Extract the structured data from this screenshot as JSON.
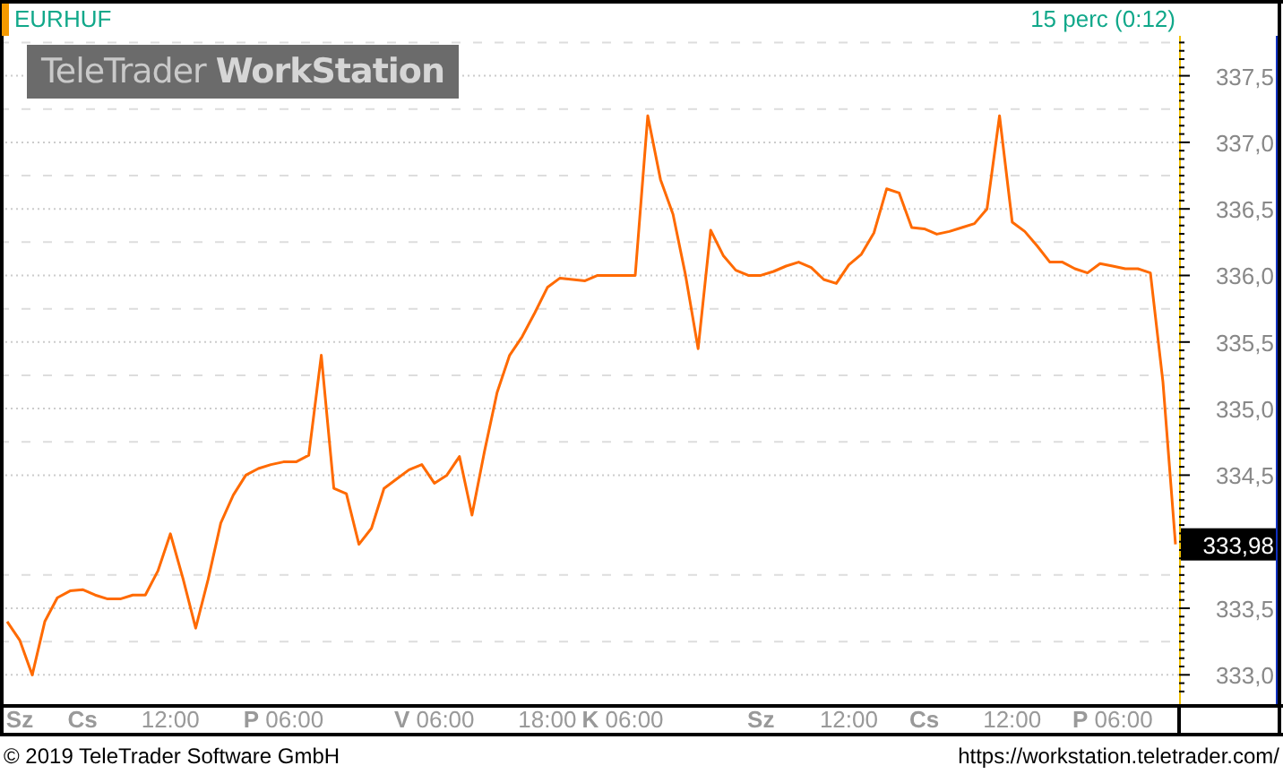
{
  "header": {
    "interval": "15 perc (0:12)"
  },
  "logo": "TeleTrader **WorkStation**",
  "last_price": "333,98",
  "chart_data": {
    "type": "line",
    "grid": true,
    "ylim": [
      332.78,
      337.8
    ],
    "categories": [
      null,
      "**Sz**",
      null,
      null,
      null,
      null,
      "**Cs**",
      null,
      null,
      null,
      null,
      null,
      null,
      "12:00",
      null,
      null,
      null,
      null,
      null,
      null,
      null,
      null,
      "**P** 06:00",
      null,
      null,
      null,
      null,
      null,
      null,
      null,
      null,
      null,
      null,
      null,
      "**V** 06:00",
      null,
      null,
      null,
      null,
      null,
      null,
      null,
      null,
      "18:00",
      null,
      null,
      null,
      null,
      null,
      "**K** 06:00",
      null,
      null,
      null,
      null,
      null,
      null,
      null,
      null,
      null,
      null,
      "**Sz**",
      null,
      null,
      null,
      null,
      null,
      null,
      "12:00",
      null,
      null,
      null,
      null,
      null,
      "**Cs**",
      null,
      null,
      null,
      null,
      null,
      null,
      "12:00",
      null,
      null,
      null,
      null,
      null,
      null,
      null,
      "**P** 06:00",
      null,
      null,
      null,
      null,
      null
    ],
    "series": [
      {
        "name": "EURHUF",
        "color": "#ff6a00",
        "values": [
          333.4,
          333.26,
          333.0,
          333.4,
          333.58,
          333.63,
          333.64,
          333.6,
          333.57,
          333.57,
          333.6,
          333.6,
          333.78,
          334.06,
          333.72,
          333.35,
          333.72,
          334.14,
          334.35,
          334.5,
          334.55,
          334.58,
          334.6,
          334.6,
          334.65,
          335.4,
          334.4,
          334.36,
          333.98,
          334.1,
          334.4,
          334.47,
          334.54,
          334.58,
          334.44,
          334.5,
          334.64,
          334.2,
          334.68,
          335.12,
          335.4,
          335.54,
          335.72,
          335.91,
          335.98,
          335.97,
          335.96,
          336.0,
          336.0,
          336.0,
          336.0,
          337.2,
          336.72,
          336.46,
          336.0,
          335.45,
          336.34,
          336.15,
          336.04,
          336.0,
          336.0,
          336.03,
          336.07,
          336.1,
          336.06,
          335.97,
          335.94,
          336.08,
          336.16,
          336.32,
          336.65,
          336.62,
          336.36,
          336.35,
          336.31,
          336.33,
          336.36,
          336.39,
          336.5,
          337.2,
          336.4,
          336.33,
          336.22,
          336.1,
          336.1,
          336.05,
          336.02,
          336.09,
          336.07,
          336.05,
          336.05,
          336.02,
          335.2,
          333.98
        ]
      }
    ],
    "yticks": [
      {
        "value": 333,
        "label": "333,0"
      },
      {
        "value": 333.5,
        "label": "333,5"
      },
      {
        "value": 334.5,
        "label": "334,5"
      },
      {
        "value": 335,
        "label": "335,0"
      },
      {
        "value": 335.5,
        "label": "335,5"
      },
      {
        "value": 336,
        "label": "336,0"
      },
      {
        "value": 336.5,
        "label": "336,5"
      },
      {
        "value": 337,
        "label": "337,0"
      },
      {
        "value": 337.5,
        "label": "337,5"
      }
    ]
  },
  "footer": {
    "copyright": "© 2019 TeleTrader Software GmbH",
    "url": "https://workstation.teletrader.com/"
  }
}
